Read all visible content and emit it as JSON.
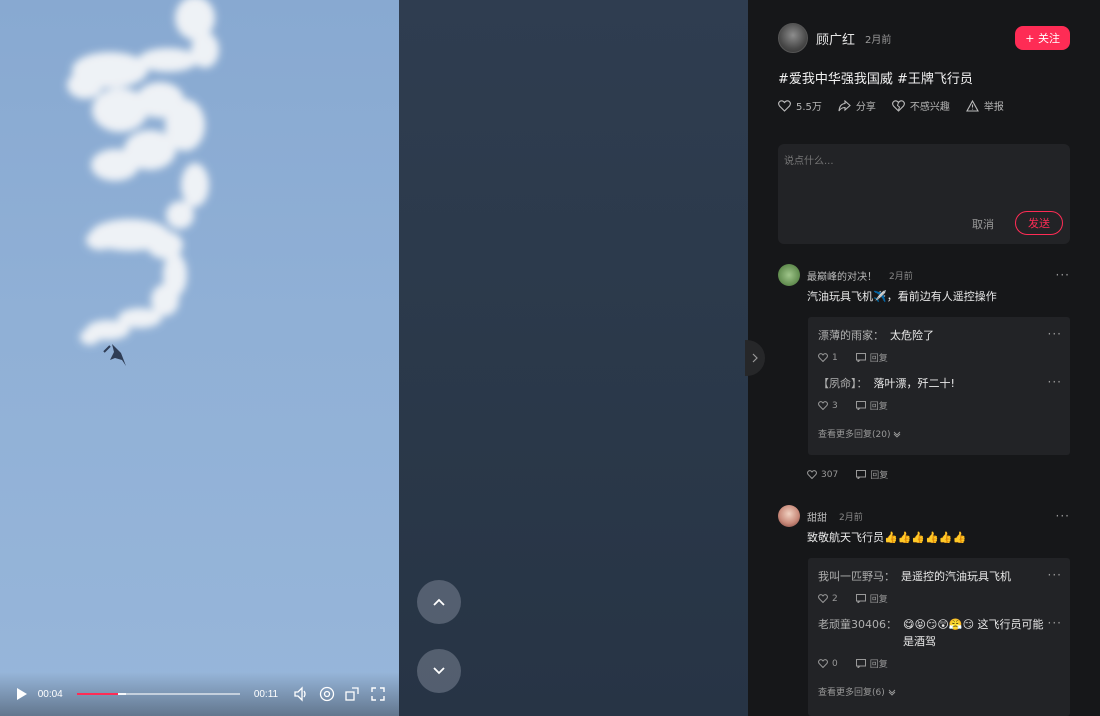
{
  "video": {
    "current_time": "00:04",
    "duration": "00:11",
    "progress_fraction": 0.25
  },
  "author": {
    "name": "顾广红",
    "time": "2月前",
    "follow_label": "+ 关注"
  },
  "caption": "#爱我中华强我国威 #王牌飞行员",
  "actions": {
    "likes": "5.5万",
    "share": "分享",
    "not_interested": "不感兴趣",
    "report": "举报"
  },
  "comment_box": {
    "placeholder": "说点什么...",
    "cancel": "取消",
    "send": "发送"
  },
  "comments": [
    {
      "user": "最巅峰的对决！",
      "time": "2月前",
      "text": "汽油玩具飞机✈️，看前边有人遥控操作",
      "likes": "307",
      "reply_label": "回复",
      "replies": [
        {
          "user": "漂薄的雨家：",
          "text": "太危险了",
          "likes": "1",
          "reply_label": "回复"
        },
        {
          "user": "【夙命】：",
          "text": "落叶漂，歼二十!",
          "likes": "3",
          "reply_label": "回复"
        }
      ],
      "view_more": "查看更多回复(20)"
    },
    {
      "user": "甜甜",
      "time": "2月前",
      "text": "致敬航天飞行员👍👍👍👍👍👍",
      "replies": [
        {
          "user": "我叫一匹野马：",
          "text": "是遥控的汽油玩具飞机",
          "likes": "2",
          "reply_label": "回复"
        },
        {
          "user": "老顽童30406：",
          "text": "😋😝😏😲😤😏 这飞行员可能是酒驾",
          "likes": "0",
          "reply_label": "回复"
        }
      ],
      "view_more": "查看更多回复(6)"
    }
  ],
  "colors": {
    "accent": "#fe2c55",
    "panel_bg": "#161719",
    "sky": "#90b0d6"
  },
  "icons": [
    "play-icon",
    "volume-icon",
    "settings-icon",
    "rotate-icon",
    "fullscreen-icon",
    "chevron-up-icon",
    "chevron-down-icon",
    "chevron-right-icon",
    "heart-icon",
    "share-icon",
    "heart-broken-icon",
    "warning-icon",
    "comment-icon"
  ]
}
